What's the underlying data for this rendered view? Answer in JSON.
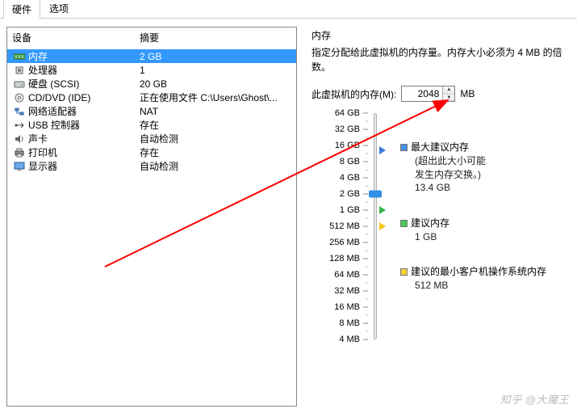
{
  "tabs": {
    "hardware": "硬件",
    "options": "选项"
  },
  "left": {
    "header_device": "设备",
    "header_summary": "摘要",
    "rows": [
      {
        "name": "内存",
        "summary": "2 GB",
        "selected": true
      },
      {
        "name": "处理器",
        "summary": "1"
      },
      {
        "name": "硬盘 (SCSI)",
        "summary": "20 GB"
      },
      {
        "name": "CD/DVD (IDE)",
        "summary": "正在使用文件 C:\\Users\\Ghost\\..."
      },
      {
        "name": "网络适配器",
        "summary": "NAT"
      },
      {
        "name": "USB 控制器",
        "summary": "存在"
      },
      {
        "name": "声卡",
        "summary": "自动检测"
      },
      {
        "name": "打印机",
        "summary": "存在"
      },
      {
        "name": "显示器",
        "summary": "自动检测"
      }
    ]
  },
  "right": {
    "title": "内存",
    "desc": "指定分配给此虚拟机的内存量。内存大小必须为 4 MB 的倍数。",
    "input_label": "此虚拟机的内存(M):",
    "input_value": "2048",
    "unit": "MB",
    "scale": [
      "64 GB",
      "32 GB",
      "16 GB",
      "8 GB",
      "4 GB",
      "2 GB",
      "1 GB",
      "512 MB",
      "256 MB",
      "128 MB",
      "64 MB",
      "32 MB",
      "16 MB",
      "8 MB",
      "4 MB"
    ],
    "legend": {
      "max": {
        "label": "最大建议内存",
        "sub1": "(超出此大小可能",
        "sub2": "发生内存交换。)",
        "val": "13.4 GB"
      },
      "rec": {
        "label": "建议内存",
        "val": "1 GB"
      },
      "min": {
        "label": "建议的最小客户机操作系统内存",
        "val": "512 MB"
      }
    }
  },
  "watermark": "知乎 @大魔王"
}
